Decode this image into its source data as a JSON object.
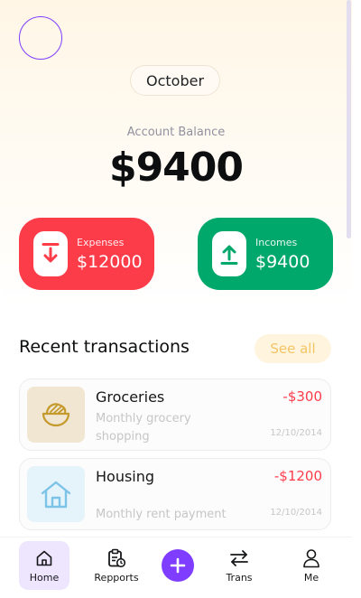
{
  "header": {
    "month": "October",
    "balance_label": "Account Balance",
    "balance_amount": "$9400"
  },
  "stats": {
    "expenses": {
      "label": "Expenses",
      "value": "$12000",
      "color": "#fd3c4a",
      "icon": "arrow-down-icon"
    },
    "incomes": {
      "label": "Incomes",
      "value": "$9400",
      "color": "#00a86b",
      "icon": "arrow-up-icon"
    }
  },
  "recent": {
    "title": "Recent transactions",
    "see_all_label": "See all",
    "items": [
      {
        "title": "Groceries",
        "description": "Monthly grocery shopping",
        "amount": "-$300",
        "date": "12/10/2014",
        "icon": "grocery-bowl-icon"
      },
      {
        "title": "Housing",
        "description": "Monthly rent payment",
        "amount": "-$1200",
        "date": "12/10/2014",
        "icon": "house-icon"
      }
    ]
  },
  "nav": {
    "items": [
      {
        "label": "Home",
        "icon": "home-icon",
        "active": true
      },
      {
        "label": "Repports",
        "icon": "report-clipboard-icon",
        "active": false
      },
      {
        "label": "",
        "icon": "plus-icon",
        "active": false
      },
      {
        "label": "Trans",
        "icon": "swap-arrows-icon",
        "active": false
      },
      {
        "label": "Me",
        "icon": "user-icon",
        "active": false
      }
    ]
  },
  "colors": {
    "accent": "#7f3dff",
    "danger": "#fd3c4a",
    "success": "#00a86b"
  }
}
